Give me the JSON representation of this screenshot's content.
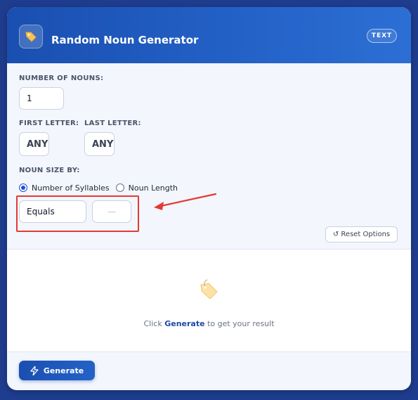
{
  "header": {
    "title": "Random Noun Generator",
    "badge": "TEXT",
    "icon": "tag-icon"
  },
  "options": {
    "number_of_nouns": {
      "label": "NUMBER OF NOUNS:",
      "value": "1"
    },
    "first_letter": {
      "label": "FIRST LETTER:",
      "value": "ANY"
    },
    "last_letter": {
      "label": "LAST LETTER:",
      "value": "ANY"
    },
    "noun_size": {
      "label": "NOUN SIZE BY:",
      "choices": [
        {
          "label": "Number of Syllables",
          "checked": true
        },
        {
          "label": "Noun Length",
          "checked": false
        }
      ],
      "comparison": "Equals",
      "size_value": "—"
    },
    "reset_label": "↺ Reset Options"
  },
  "result": {
    "prefix": "Click",
    "link": "Generate",
    "suffix": "to get your result",
    "icon": "tag-icon"
  },
  "footer": {
    "generate_label": "Generate",
    "icon": "lightning-icon"
  },
  "colors": {
    "brand": "#1a4fb0",
    "highlight": "#e53935",
    "tag": "#f6c453"
  }
}
